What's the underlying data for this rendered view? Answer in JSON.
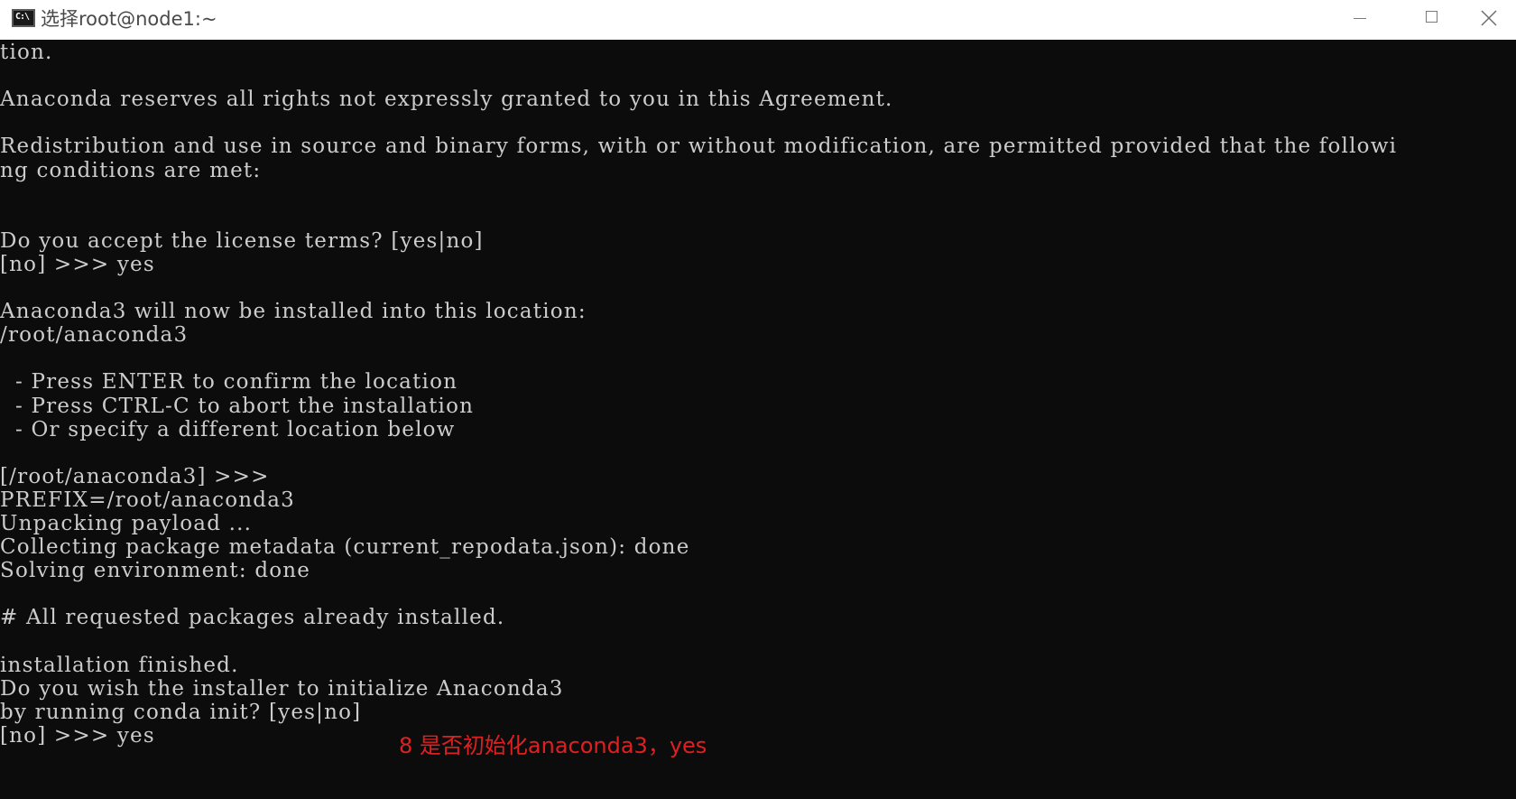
{
  "window": {
    "title": "选择root@node1:~",
    "icon": "console-icon",
    "controls": {
      "minimize": "minimize-icon",
      "maximize": "maximize-icon",
      "close": "close-icon"
    }
  },
  "terminal": {
    "lines": [
      "tion.",
      "",
      "Anaconda reserves all rights not expressly granted to you in this Agreement.",
      "",
      "Redistribution and use in source and binary forms, with or without modification, are permitted provided that the followi",
      "ng conditions are met:",
      "",
      "",
      "Do you accept the license terms? [yes|no]",
      "[no] >>> yes",
      "",
      "Anaconda3 will now be installed into this location:",
      "/root/anaconda3",
      "",
      "  - Press ENTER to confirm the location",
      "  - Press CTRL-C to abort the installation",
      "  - Or specify a different location below",
      "",
      "[/root/anaconda3] >>>",
      "PREFIX=/root/anaconda3",
      "Unpacking payload ...",
      "Collecting package metadata (current_repodata.json): done",
      "Solving environment: done",
      "",
      "# All requested packages already installed.",
      "",
      "installation finished.",
      "Do you wish the installer to initialize Anaconda3",
      "by running conda init? [yes|no]",
      "[no] >>> yes"
    ]
  },
  "annotation": {
    "text": "8 是否初始化anaconda3，yes",
    "color": "#e02020"
  },
  "colors": {
    "terminal_bg": "#0c0c0c",
    "terminal_fg": "#cccccc",
    "titlebar_bg": "#ffffff"
  }
}
